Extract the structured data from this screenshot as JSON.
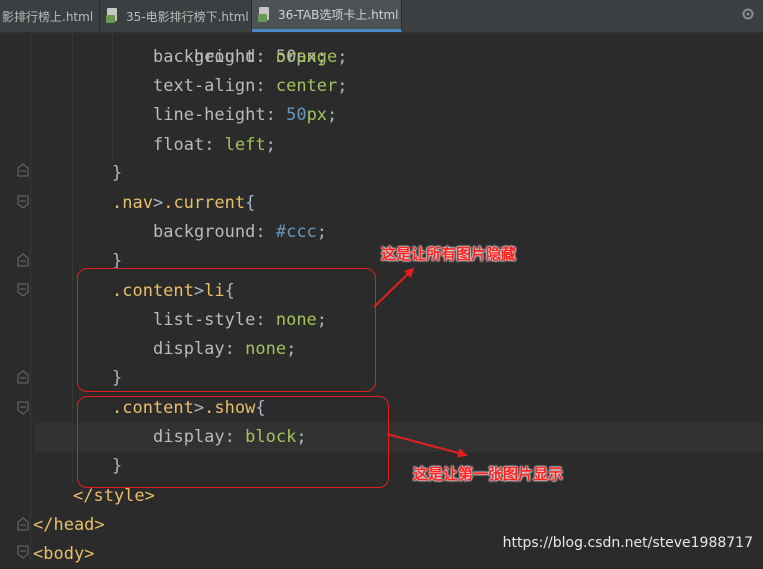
{
  "tabs": [
    {
      "label": "影排行榜上.html",
      "close": "×",
      "active": false
    },
    {
      "label": "35-电影排行榜下.html",
      "close": "×",
      "active": false
    },
    {
      "label": "36-TAB选项卡上.html",
      "close": "×",
      "active": true
    }
  ],
  "code": {
    "partial_top": "height: 50px;",
    "l1": {
      "prop": "background",
      "value": "orange"
    },
    "l2": {
      "prop": "text-align",
      "value": "center"
    },
    "l3": {
      "prop": "line-height",
      "num": "50",
      "unit": "px"
    },
    "l4": {
      "prop": "float",
      "value": "left"
    },
    "l5": {
      "brace": "}"
    },
    "l6": {
      "sel1": ".nav",
      "gt": ">",
      "sel2": ".current",
      "brace": "{"
    },
    "l7": {
      "prop": "background",
      "value": "#ccc"
    },
    "l8": {
      "brace": "}"
    },
    "l9": {
      "sel1": ".content",
      "gt": ">",
      "sel2": "li",
      "brace": "{"
    },
    "l10": {
      "prop": "list-style",
      "value": "none"
    },
    "l11": {
      "prop": "display",
      "value": "none"
    },
    "l12": {
      "brace": "}"
    },
    "l13": {
      "sel1": ".content",
      "gt": ">",
      "sel2": ".show",
      "brace": "{"
    },
    "l14": {
      "prop": "display",
      "value": "block"
    },
    "l15": {
      "brace": "}"
    },
    "l16": {
      "tag": "</style>"
    },
    "l17": {
      "tag": "</head>"
    },
    "l18": {
      "tag": "<body>"
    }
  },
  "annotations": {
    "note1": "这是让所有图片隐藏",
    "note2": "这是让第一张图片显示",
    "color": "#e02020"
  },
  "watermark": "https://blog.csdn.net/steve1988717"
}
